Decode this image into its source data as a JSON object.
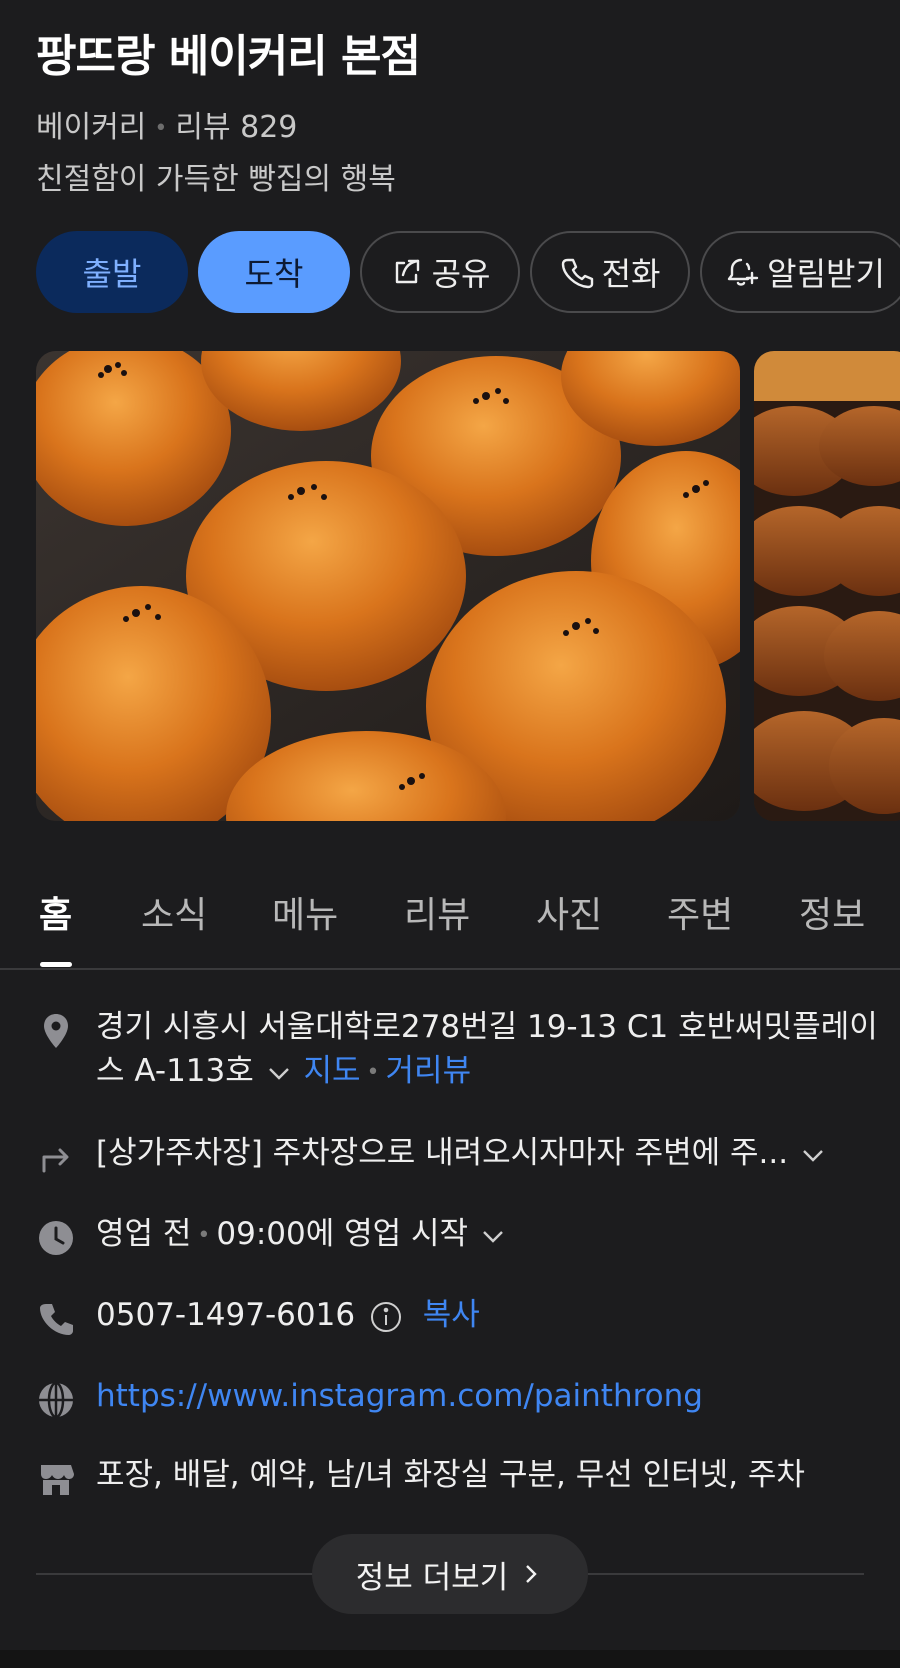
{
  "place": {
    "name": "팡뜨랑 베이커리 본점",
    "category": "베이커리",
    "review_label": "리뷰 829",
    "description": "친절함이 가득한 빵집의 행복"
  },
  "actions": {
    "depart": "출발",
    "arrive": "도착",
    "share": "공유",
    "call": "전화",
    "alarm": "알림받기"
  },
  "tabs": [
    "홈",
    "소식",
    "메뉴",
    "리뷰",
    "사진",
    "주변",
    "정보"
  ],
  "info": {
    "address_line1": "경기 시흥시 서울대학로278번길 19-13 C1 호반써밋플레이",
    "address_line2": "스 A-113호",
    "map_link": "지도",
    "street_view_link": "거리뷰",
    "directions": "[상가주차장] 주차장으로 내려오시자마자 주변에 주...",
    "hours_status": "영업 전",
    "hours_detail": "09:00에 영업 시작",
    "phone": "0507-1497-6016",
    "copy_label": "복사",
    "website": "https://www.instagram.com/painthrong",
    "amenities": "포장, 배달, 예약, 남/녀 화장실 구분, 무선 인터넷, 주차"
  },
  "more_button": "정보 더보기",
  "colors": {
    "background": "#1c1c1e",
    "link": "#3f86f2",
    "depart_bg": "#0b2a5c",
    "arrive_bg": "#5a9cff"
  }
}
